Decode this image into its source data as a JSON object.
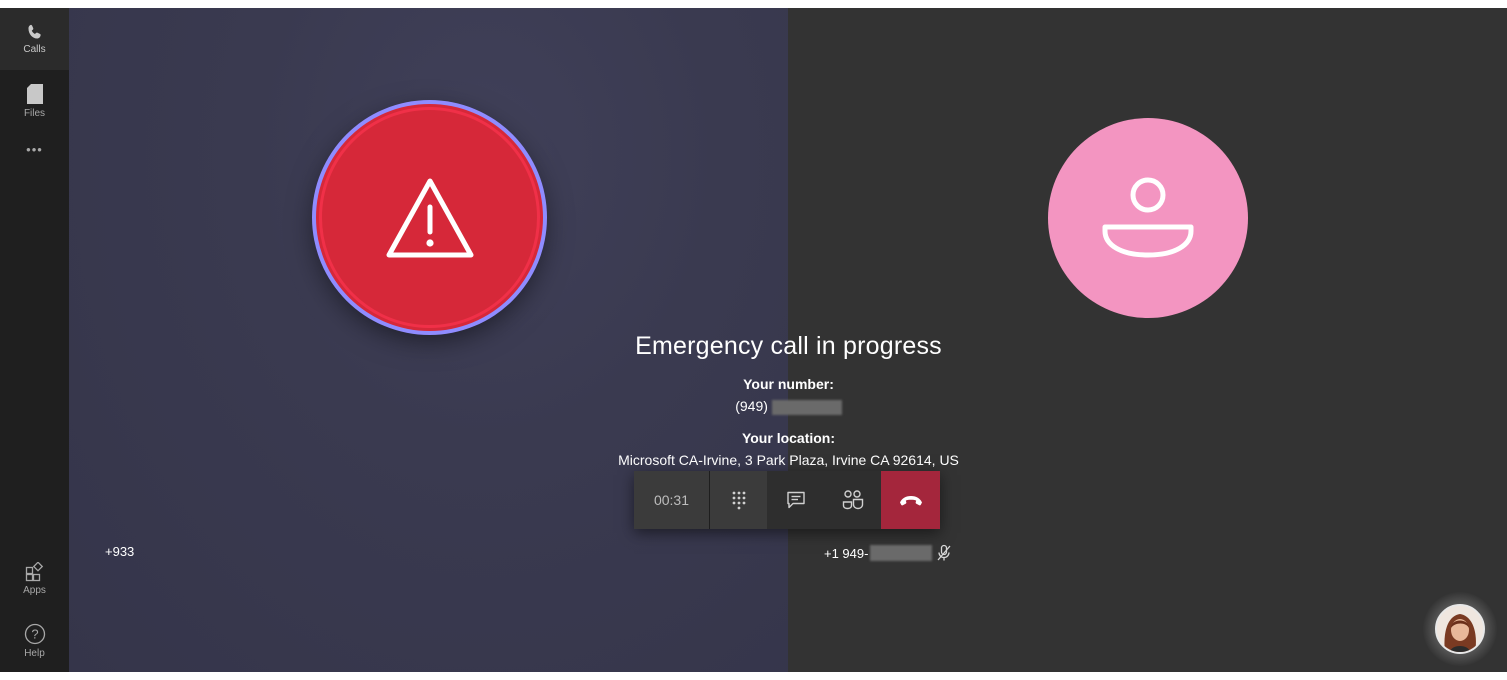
{
  "rail": {
    "calls_label": "Calls",
    "files_label": "Files",
    "more_label": "•••",
    "apps_label": "Apps",
    "help_label": "Help"
  },
  "call": {
    "title": "Emergency call in progress",
    "your_number_label": "Your number:",
    "your_number_prefix": "(949)",
    "your_location_label": "Your location:",
    "your_location": "Microsoft CA-Irvine, 3 Park Plaza, Irvine CA 92614, US",
    "timer": "00:31"
  },
  "participants": {
    "left_name": "+933",
    "right_name_prefix": "+1 949-"
  },
  "colors": {
    "emergency": "#d62839",
    "emergency_ring": "#8f8cff",
    "person_avatar": "#f395c1",
    "hangup": "#a4263c"
  },
  "icons": [
    "phone-icon",
    "file-icon",
    "more-icon",
    "apps-icon",
    "help-icon",
    "warning-icon",
    "person-icon",
    "dialpad-icon",
    "chat-icon",
    "participants-icon",
    "hangup-icon",
    "mic-off-icon"
  ]
}
